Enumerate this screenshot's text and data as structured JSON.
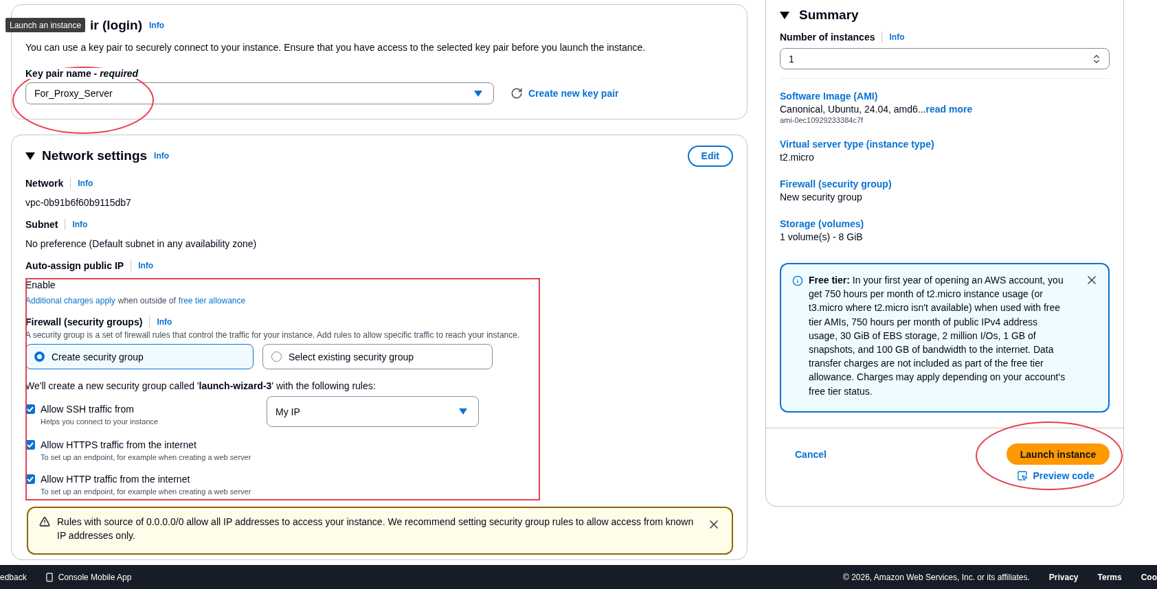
{
  "tooltip": "Launch an instance",
  "key_pair": {
    "title": "ir (login)",
    "info": "Info",
    "description": "You can use a key pair to securely connect to your instance. Ensure that you have access to the selected key pair before you launch the instance.",
    "field_label": "Key pair name - *required*",
    "value": "For_Proxy_Server",
    "create_link": "Create new key pair"
  },
  "network_settings": {
    "expanded": true,
    "title": "Network settings",
    "info": "Info",
    "edit": "Edit",
    "fields": [
      {
        "label": "Network",
        "info": "Info",
        "value": "vpc-0b91b6f60b9115db7"
      },
      {
        "label": "Subnet",
        "info": "Info",
        "value": "No preference (Default subnet in any availability zone)"
      },
      {
        "label": "Auto-assign public IP",
        "info": "Info",
        "value": "Enable"
      }
    ],
    "charges_note": {
      "link": "Additional charges apply",
      "text": "when outside of",
      "link_2": "free tier allowance"
    },
    "firewall": {
      "label": "Firewall (security groups)",
      "info": "Info",
      "description": "A security group is a set of firewall rules that control the traffic for your instance. Add rules to allow specific traffic to reach your instance.",
      "options": [
        {
          "label": "Create security group",
          "selected": true
        },
        {
          "label": "Select existing security group",
          "selected": false
        }
      ],
      "rules_intro": "We'll create a new security group called '**launch-wizard-3**' with the following rules:",
      "rules": [
        {
          "label": "Allow SSH traffic from",
          "hint": "Helps you connect to your instance",
          "checked": true,
          "source": "My IP"
        },
        {
          "label": "Allow HTTPS traffic from the internet",
          "hint": "To set up an endpoint, for example when creating a web server",
          "checked": true
        },
        {
          "label": "Allow HTTP traffic from the internet",
          "hint": "To set up an endpoint, for example when creating a web server",
          "checked": true
        }
      ]
    },
    "warning": "Rules with source of 0.0.0.0/0 allow all IP addresses to access your instance. We recommend setting security group rules to allow access from known IP addresses only."
  },
  "summary": {
    "expanded": true,
    "title": "Summary",
    "instances_label": "Number of instances",
    "info": "Info",
    "instances_value": "1",
    "items": [
      {
        "title": "Software Image (AMI)",
        "value": "Canonical, Ubuntu, 24.04, amd6...",
        "more": "read more",
        "detail": "ami-0ec10929233384c7f"
      },
      {
        "title": "Virtual server type (instance type)",
        "value": "t2.micro"
      },
      {
        "title": "Firewall (security group)",
        "value": "New security group"
      },
      {
        "title": "Storage (volumes)",
        "value": "1 volume(s) - 8 GiB"
      }
    ],
    "free_tier": "**Free tier:** In your first year of opening an AWS account, you get 750 hours per month of t2.micro instance usage (or t3.micro where t2.micro isn't available) when used with free tier AMIs, 750 hours per month of public IPv4 address usage, 30 GiB of EBS storage, 2 million I/Os, 1 GB of snapshots, and 100 GB of bandwidth to the internet. Data transfer charges are not included as part of the free tier allowance. Charges may apply depending on your account's free tier status.",
    "cancel": "Cancel",
    "launch": "Launch instance",
    "preview": "Preview code"
  },
  "annotations": [
    {
      "kind": "ellipse"
    },
    {
      "kind": "rectangle"
    },
    {
      "kind": "ellipse"
    }
  ],
  "footer": {
    "feedback": "edback",
    "mobile_app": "Console Mobile App",
    "copyright": "© 2026, Amazon Web Services, Inc. or its affiliates.",
    "links": [
      "Privacy",
      "Terms",
      "Coo"
    ]
  }
}
